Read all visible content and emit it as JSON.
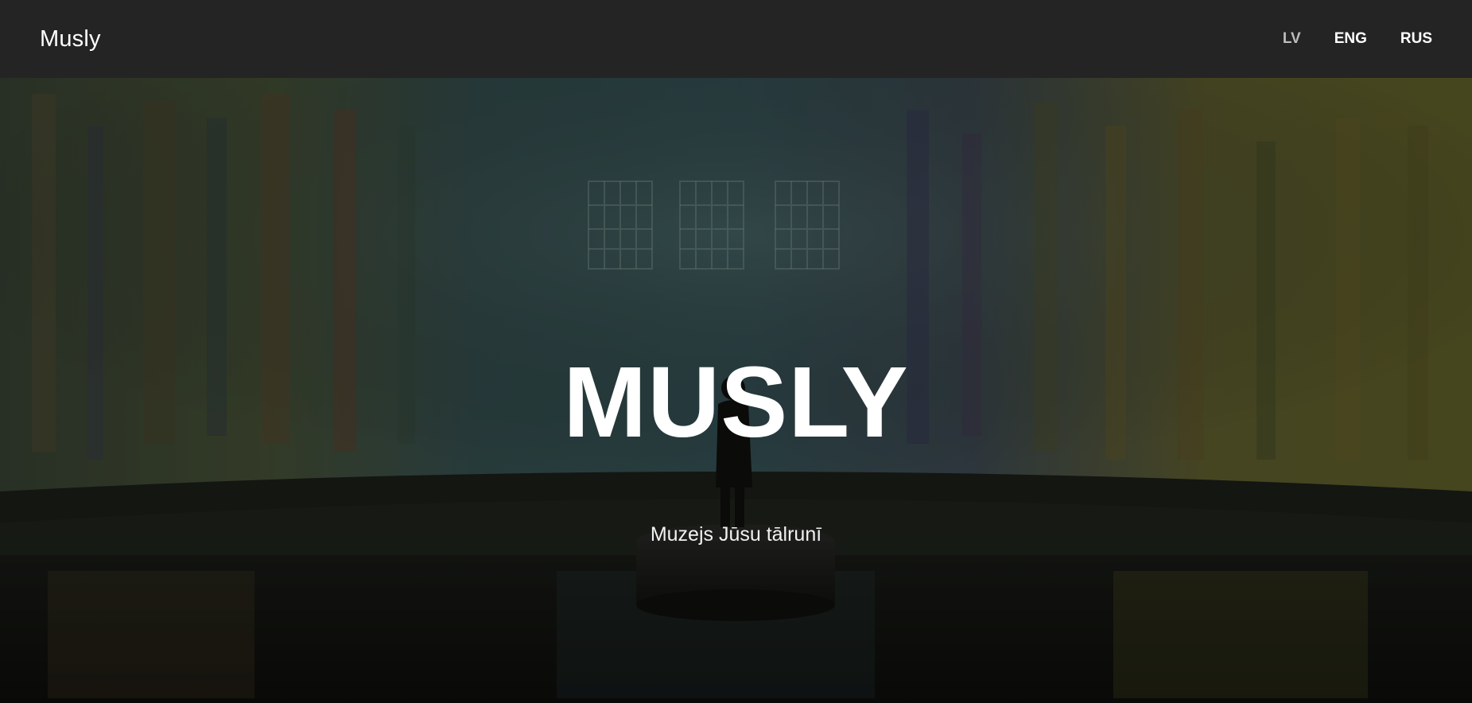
{
  "navbar": {
    "brand": "Musly",
    "languages": [
      {
        "label": "LV",
        "active": true
      },
      {
        "label": "ENG",
        "active": false
      },
      {
        "label": "RUS",
        "active": false
      }
    ]
  },
  "hero": {
    "title": "MUSLY",
    "subtitle": "Muzejs Jūsu tālrunī"
  },
  "colors": {
    "navbar_bg": "#242424",
    "text": "#ffffff",
    "active_lang": "#bdbdbd"
  }
}
